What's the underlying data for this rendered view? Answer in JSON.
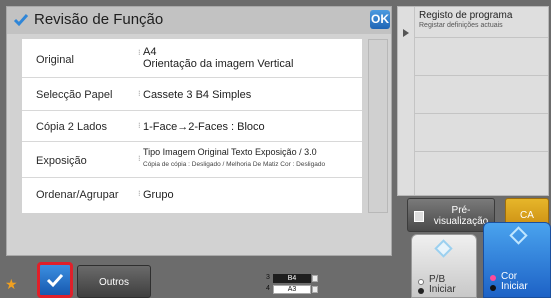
{
  "title": "Revisão de Função",
  "ok_label": "OK",
  "rows": [
    {
      "label": "Original",
      "value_line1": "A4",
      "value_line2": "Orientação da imagem Vertical"
    },
    {
      "label": "Selecção Papel",
      "value": "Cassete 3 B4 Simples"
    },
    {
      "label": "Cópia 2 Lados",
      "value": "1-Face→2-Faces : Bloco"
    },
    {
      "label": "Exposição",
      "value_line1": "Tipo Imagem Original Texto Exposição / 3.0",
      "value_line2": "Cópia de cópia : Desligado / Melhoria De Matiz Cor : Desligado"
    },
    {
      "label": "Ordenar/Agrupar",
      "value": "Grupo"
    }
  ],
  "program_panel": {
    "title": "Registo de programa",
    "subtitle": "Registar definições actuais"
  },
  "preview_label_1": "Pré-",
  "preview_label_2": "visualização",
  "ca_label": "CA",
  "pb_label_1": "P/B",
  "pb_label_2": "Iniciar",
  "cor_label_1": "Cor",
  "cor_label_2": "Iniciar",
  "outros_label": "Outros",
  "trays": [
    {
      "num": "3",
      "size": "B4",
      "selected": true
    },
    {
      "num": "4",
      "size": "A3",
      "selected": false
    }
  ],
  "colors": {
    "accent": "#1f65b5",
    "ca": "#d9a01c",
    "highlight": "#e0202a"
  }
}
